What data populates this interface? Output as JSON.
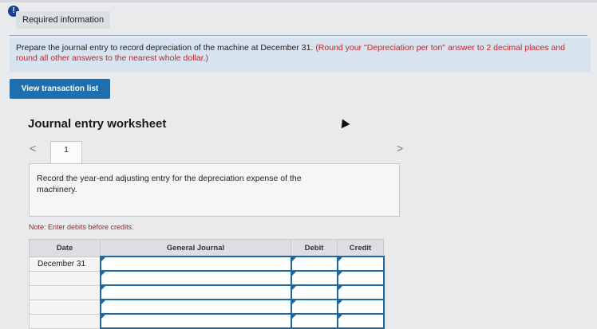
{
  "header": {
    "required_label": "Required information",
    "alert_icon": "!"
  },
  "instructions": {
    "main": "Prepare the journal entry to record depreciation of the machine at December 31.",
    "round_note": "(Round your \"Depreciation per ton\" answer to 2 decimal places and round all other answers to the nearest whole dollar.)"
  },
  "buttons": {
    "view_transaction_list": "View transaction list"
  },
  "worksheet": {
    "title": "Journal entry worksheet",
    "prev": "<",
    "next": ">",
    "tab_number": "1",
    "entry_description": "Record the year-end adjusting entry for the depreciation expense of the machinery.",
    "note": "Note: Enter debits before credits."
  },
  "table": {
    "headers": {
      "date": "Date",
      "journal": "General Journal",
      "debit": "Debit",
      "credit": "Credit"
    },
    "rows": [
      {
        "date": "December 31"
      },
      {
        "date": ""
      },
      {
        "date": ""
      },
      {
        "date": ""
      },
      {
        "date": ""
      }
    ]
  },
  "colors": {
    "accent": "#1e6fb0",
    "instruction_bg": "#d7e3ef",
    "warning_text": "#c0262d"
  }
}
